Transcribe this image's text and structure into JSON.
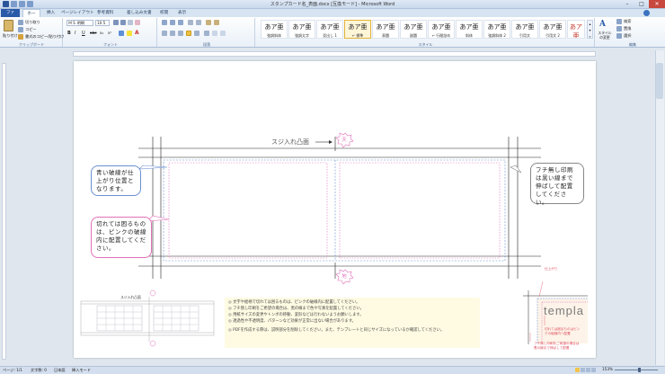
{
  "window": {
    "title": "スタンプカード名_表面.docx [互換モード] - Microsoft Word",
    "controls": [
      "–",
      "□",
      "✕"
    ]
  },
  "ribbon_tabs": [
    "ファイル",
    "ホーム",
    "挿入",
    "ページレイアウト",
    "参考資料",
    "差し込み文書",
    "校閲",
    "表示"
  ],
  "clipboard": {
    "paste": "貼り付け",
    "cut": "切り取り",
    "copy": "コピー",
    "format_painter": "書式のコピー/貼り付け",
    "label": "クリップボード"
  },
  "font": {
    "name": "ＭＳ 明朝",
    "size": "10.5",
    "buttons": [
      "B",
      "I",
      "U",
      "abc",
      "x₂",
      "x²",
      "A"
    ],
    "label": "フォント"
  },
  "paragraph": {
    "label": "段落"
  },
  "styles": {
    "items": [
      {
        "sample": "あア亜",
        "name": "強調斜体"
      },
      {
        "sample": "あア亜",
        "name": "強調太字"
      },
      {
        "sample": "あア亜",
        "name": "見出し 1"
      },
      {
        "sample": "あア亜",
        "name": "↵ 標準"
      },
      {
        "sample": "あア亜",
        "name": "表題"
      },
      {
        "sample": "あア亜",
        "name": "副題"
      },
      {
        "sample": "あア亜",
        "name": "↵ 行間詰め"
      },
      {
        "sample": "あア亜",
        "name": "斜体"
      },
      {
        "sample": "あア亜",
        "name": "強調斜体 2"
      },
      {
        "sample": "あア亜",
        "name": "引用文"
      },
      {
        "sample": "あア亜",
        "name": "引用文 2"
      },
      {
        "sample": "あア亜",
        "name": "参照"
      },
      {
        "sample": "あア亜",
        "name": "参照 2"
      }
    ],
    "change_styles": "スタイルの変更",
    "label": "スタイル"
  },
  "editing": {
    "find": "検索",
    "replace": "置換",
    "select": "選択",
    "label": "編集"
  },
  "document": {
    "crease_label": "スジ入れ凸面",
    "top_badge": "天",
    "bottom_badge": "地",
    "note_blue": "青い破線が仕上がり位置となります。",
    "note_pink": "切れては困るものは、ピンクの破線内に配置してください。",
    "note_gray": "フチ無し印刷は黒い線まで伸ばして配置してください。",
    "thumb_label": "スジ入れ凸面",
    "tips": [
      "文字や絵柄で切れては困るものは、ピンクの破線内に配置してください。",
      "フチ無し印刷をご希望の場合は、黒の線まで色や写真を配置してください。",
      "用紙サイズの変更やトンボの移動、変形などは行わないようお願いします。",
      "透過性や不透明度、パターンなど効果が正常に出ない場合があります。",
      "PDFを作成する際は、説明部分を削除してください。また、テンプレートと同じサイズになっているか確認してください。"
    ],
    "legend_blue": "仕上がり",
    "legend_pink": "切れては困るものはピンクの破線内へ配置",
    "legend_black": "フチ無し印刷をご希望の場合は黒の線まで伸ばして配置",
    "template_word": "templa"
  },
  "status": {
    "page": "ページ: 1/1",
    "words": "文字数: 0",
    "language": "日本語",
    "mode": "挿入モード",
    "zoom": "153%"
  },
  "colors": {
    "accent": "#2a5ba8",
    "blue_guide": "#6a8fd0",
    "pink_guide": "#e070b8",
    "tips_bg": "#fffbe3"
  }
}
